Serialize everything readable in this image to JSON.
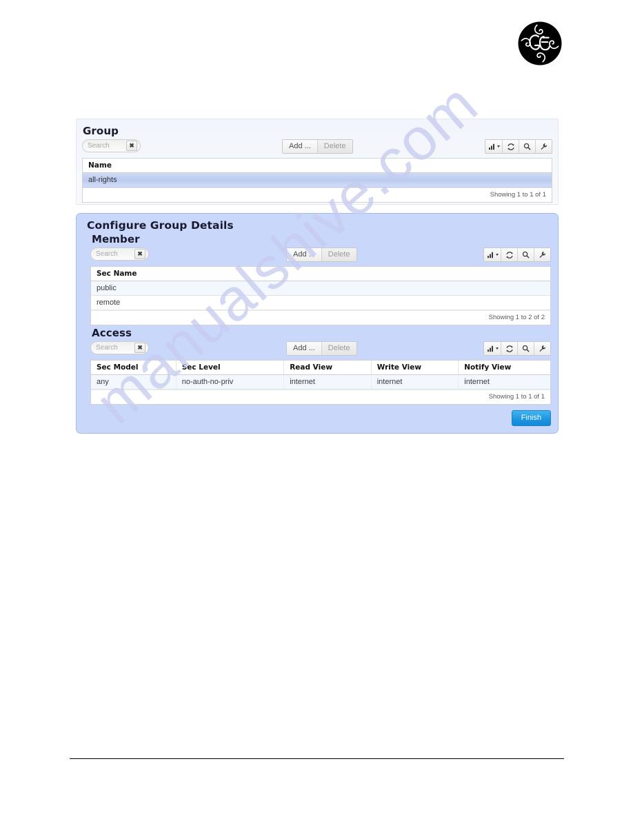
{
  "page": {
    "watermark": "manualshive.com",
    "logo_alt": "GE monogram logo"
  },
  "group_panel": {
    "title": "Group",
    "search": {
      "value": "",
      "placeholder": "Search",
      "clear_label": "✖"
    },
    "actions": {
      "add_label": "Add ...",
      "delete_label": "Delete"
    },
    "icons": {
      "chart_label": "chart-icon",
      "refresh_label": "refresh-icon",
      "search_label": "search-icon",
      "wrench_label": "wrench-icon"
    },
    "table": {
      "columns": [
        "Name"
      ],
      "rows": [
        [
          "all-rights"
        ]
      ],
      "selected_row": 0,
      "footer": "Showing 1 to 1 of 1"
    }
  },
  "configure_panel": {
    "title": "Configure Group Details",
    "member": {
      "title": "Member",
      "search": {
        "value": "",
        "placeholder": "Search",
        "clear_label": "✖"
      },
      "actions": {
        "add_label": "Add ...",
        "delete_label": "Delete"
      },
      "table": {
        "columns": [
          "Sec Name"
        ],
        "rows": [
          [
            "public"
          ],
          [
            "remote"
          ]
        ],
        "footer": "Showing 1 to 2 of 2"
      }
    },
    "access": {
      "title": "Access",
      "search": {
        "value": "",
        "placeholder": "Search",
        "clear_label": "✖"
      },
      "actions": {
        "add_label": "Add ...",
        "delete_label": "Delete"
      },
      "table": {
        "columns": [
          "Sec Model",
          "Sec Level",
          "Read View",
          "Write View",
          "Notify View"
        ],
        "rows": [
          [
            "any",
            "no-auth-no-priv",
            "internet",
            "internet",
            "internet"
          ]
        ],
        "footer": "Showing 1 to 1 of 1"
      }
    },
    "finish_label": "Finish"
  },
  "colors": {
    "panel_blue": "#c9d8fa",
    "panel_blue_border": "#9dbbf0",
    "selected_row": "#c3d1f2",
    "finish_button": "#1f96e0",
    "watermark": "#c7ccef"
  }
}
